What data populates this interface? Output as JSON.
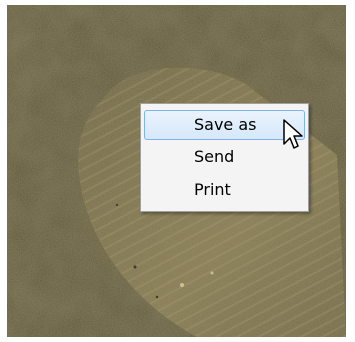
{
  "context_menu": {
    "items": [
      {
        "label": "Save as",
        "active": true
      },
      {
        "label": "Send",
        "active": false
      },
      {
        "label": "Print",
        "active": false
      }
    ]
  },
  "icons": {
    "cursor": "arrow-pointer-icon"
  },
  "colors": {
    "menu_background": "#f4f4f4",
    "menu_border": "#a0a0a0",
    "highlight_border": "#7eb4ea",
    "highlight_fill": "#dbeafb",
    "photo_base": "#5f5638"
  }
}
